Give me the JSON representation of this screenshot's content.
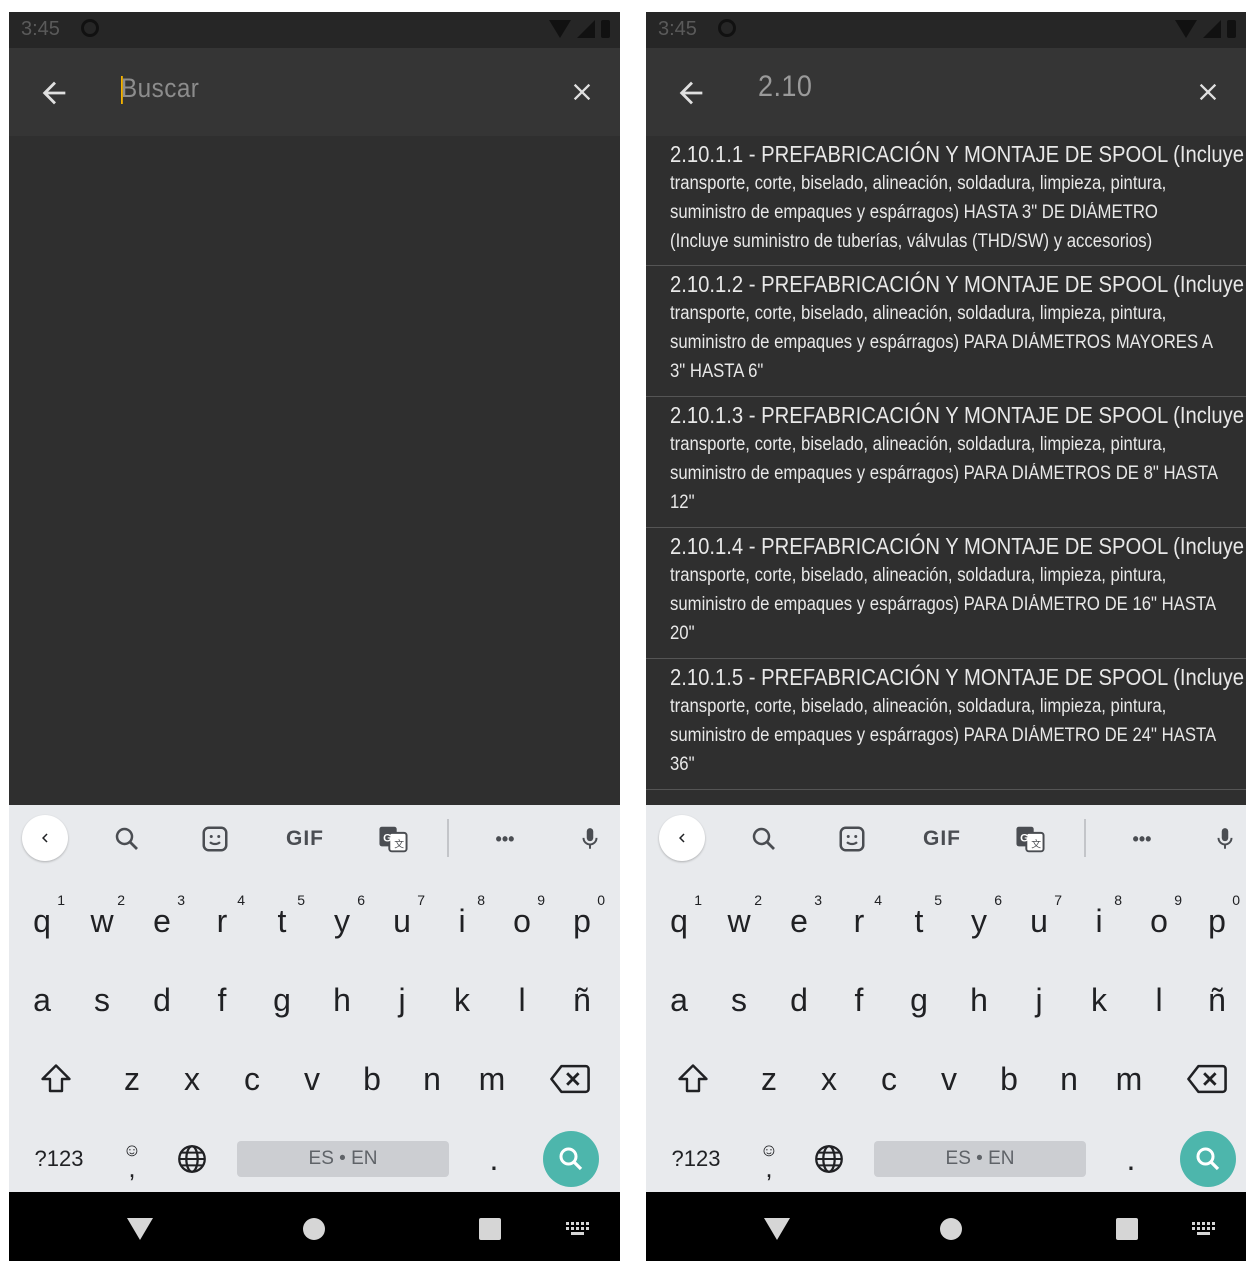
{
  "status": {
    "time": "3:45"
  },
  "search": {
    "placeholder": "Buscar",
    "query": "2.10"
  },
  "results": [
    {
      "title": "2.10.1.1 - PREFABRICACIÓN Y MONTAJE  DE SPOOL (Incluye",
      "desc_a": "transporte, corte, biselado, alineación, soldadura,  limpieza, pintura,",
      "desc_b": "suministro de  empaques y espárragos)  HASTA  3\" DE DIÁMETRO",
      "desc_c": "(Incluye  suministro de tuberías, válvulas (THD/SW) y accesorios)"
    },
    {
      "title": "2.10.1.2 - PREFABRICACIÓN Y MONTAJE  DE SPOOL (Incluye",
      "desc_a": "transporte, corte, biselado, alineación, soldadura,  limpieza, pintura,",
      "desc_b": "suministro de  empaques y espárragos) PARA DIÁMETROS MAYORES A",
      "desc_c": "3\" HASTA 6\""
    },
    {
      "title": "2.10.1.3 - PREFABRICACIÓN Y MONTAJE  DE SPOOL (Incluye",
      "desc_a": "transporte, corte, biselado, alineación, soldadura,  limpieza, pintura,",
      "desc_b": "suministro de  empaques y espárragos) PARA DIÁMETROS DE 8\" HASTA",
      "desc_c": "12\""
    },
    {
      "title": "2.10.1.4 - PREFABRICACIÓN Y MONTAJE  DE SPOOL (Incluye",
      "desc_a": "transporte, corte, biselado, alineación, soldadura,  limpieza, pintura,",
      "desc_b": "suministro de  empaques y espárragos) PARA DIÁMETRO DE 16\" HASTA",
      "desc_c": "20\""
    },
    {
      "title": "2.10.1.5 - PREFABRICACIÓN Y MONTAJE  DE SPOOL (Incluye",
      "desc_a": "transporte, corte, biselado, alineación, soldadura,  limpieza, pintura,",
      "desc_b": "suministro de  empaques y espárragos) PARA DIÁMETRO DE 24\" HASTA",
      "desc_c": "36\""
    }
  ],
  "keyboard": {
    "toolbar": {
      "gif": "GIF",
      "more": "•••"
    },
    "row1": [
      "q",
      "w",
      "e",
      "r",
      "t",
      "y",
      "u",
      "i",
      "o",
      "p"
    ],
    "row1_hints": [
      "1",
      "2",
      "3",
      "4",
      "5",
      "6",
      "7",
      "8",
      "9",
      "0"
    ],
    "row2": [
      "a",
      "s",
      "d",
      "f",
      "g",
      "h",
      "j",
      "k",
      "l",
      "ñ"
    ],
    "row3": [
      "z",
      "x",
      "c",
      "v",
      "b",
      "n",
      "m"
    ],
    "symbols": "?123",
    "emoji_comma": ",",
    "space": "ES • EN",
    "period": "."
  },
  "icons": {
    "back": "arrow-left-icon",
    "clear": "close-icon",
    "search": "search-icon",
    "sticker": "sticker-icon",
    "translate": "translate-icon",
    "mic": "microphone-icon",
    "shift": "shift-icon",
    "backspace": "backspace-icon",
    "globe": "globe-icon"
  },
  "colors": {
    "app_bg": "#2f2f2f",
    "toolbar_bg": "#353535",
    "accent_cursor": "#f5b400",
    "search_key": "#4db6ac",
    "keyboard_bg": "#e8eaed"
  }
}
